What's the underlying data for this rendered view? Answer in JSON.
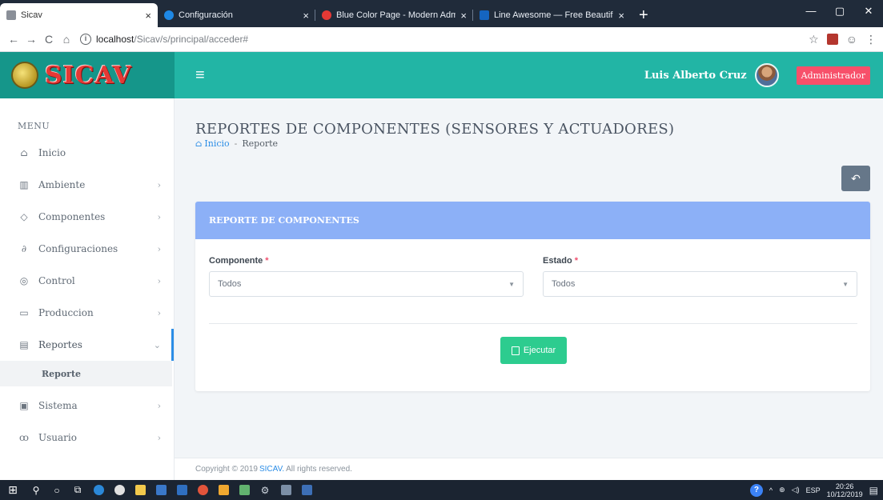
{
  "browser": {
    "tabs": [
      {
        "title": "Sicav",
        "active": true,
        "favicon_color": "#8a8f98"
      },
      {
        "title": "Configuración",
        "active": false,
        "favicon_color": "#1e88e5"
      },
      {
        "title": "Blue Color Page - Modern Admi",
        "active": false,
        "favicon_color": "#e53935"
      },
      {
        "title": "Line Awesome — Free Beautiful",
        "active": false,
        "favicon_color": "#1565c0"
      }
    ],
    "new_tab": "+",
    "url_host": "localhost",
    "url_path": "/Sicav/s/principal/acceder#",
    "nav": {
      "back": "←",
      "forward": "→",
      "reload": "C",
      "home": "⌂"
    }
  },
  "header": {
    "brand": "SICAV",
    "hamburger": "≡",
    "user_name": "Luis Alberto Cruz",
    "role": "Administrador"
  },
  "sidebar": {
    "menu_title": "MENU",
    "items": [
      {
        "label": "Inicio",
        "icon": "home-icon",
        "glyph": "⌂",
        "arrow": ""
      },
      {
        "label": "Ambiente",
        "icon": "bank-icon",
        "glyph": "▥",
        "arrow": "›"
      },
      {
        "label": "Componentes",
        "icon": "chip-icon",
        "glyph": "◇",
        "arrow": "›"
      },
      {
        "label": "Configuraciones",
        "icon": "link-icon",
        "glyph": "∂",
        "arrow": "›"
      },
      {
        "label": "Control",
        "icon": "gauge-icon",
        "glyph": "◎",
        "arrow": "›"
      },
      {
        "label": "Produccion",
        "icon": "box-icon",
        "glyph": "▭",
        "arrow": "›"
      },
      {
        "label": "Reportes",
        "icon": "chart-icon",
        "glyph": "▤",
        "arrow": "⌄"
      }
    ],
    "sub_item": "Reporte",
    "items_after": [
      {
        "label": "Sistema",
        "icon": "window-icon",
        "glyph": "▣",
        "arrow": "›"
      },
      {
        "label": "Usuario",
        "icon": "users-icon",
        "glyph": "ꝏ",
        "arrow": "›"
      }
    ]
  },
  "page": {
    "title": "REPORTES DE COMPONENTES (SENSORES Y ACTUADORES)",
    "breadcrumb_home": "Inicio",
    "breadcrumb_sep": "-",
    "breadcrumb_current": "Reporte",
    "back_glyph": "↶"
  },
  "card": {
    "header": "REPORTE DE COMPONENTES",
    "component_label": "Componente",
    "component_value": "Todos",
    "state_label": "Estado",
    "state_value": "Todos",
    "required_mark": "*",
    "run_label": "Ejecutar"
  },
  "footer": {
    "prefix": "Copyright © 2019",
    "brand": "SICAV.",
    "suffix": "All rights reserved."
  },
  "taskbar": {
    "lang": "ESP",
    "time": "20:26",
    "date": "10/12/2019"
  },
  "colors": {
    "brand_bg": "#15968a",
    "topbar_bg": "#22b5a5",
    "card_header": "#8cb0f7",
    "run_button": "#2dcc8f",
    "badge": "#f7506a"
  }
}
